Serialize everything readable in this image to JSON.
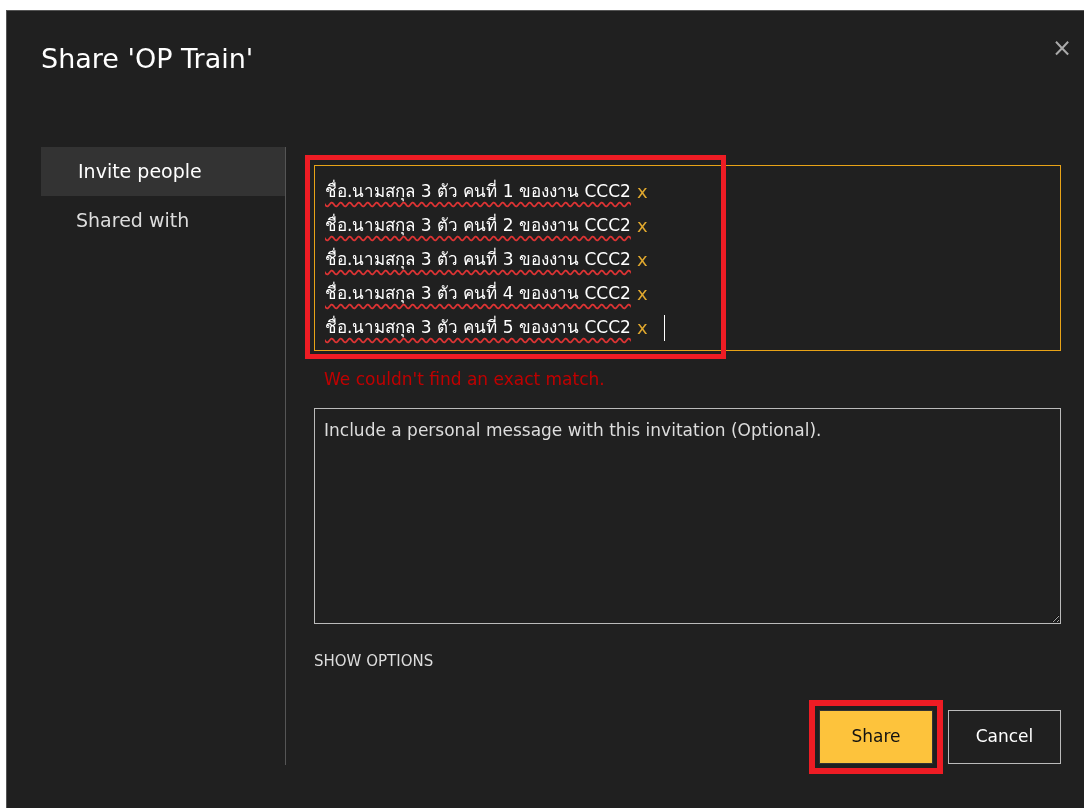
{
  "dialog": {
    "title": "Share 'OP Train'",
    "close": "×"
  },
  "sidebar": {
    "items": [
      {
        "label": "Invite people",
        "selected": true
      },
      {
        "label": "Shared with",
        "selected": false
      }
    ]
  },
  "recipients": {
    "highlighted": true,
    "items": [
      {
        "name": "ชื่อ.นามสกุล 3 ตัว คนที่ 1 ของงาน CCC2",
        "remove": "x"
      },
      {
        "name": "ชื่อ.นามสกุล 3 ตัว คนที่ 2 ของงาน CCC2",
        "remove": "x"
      },
      {
        "name": "ชื่อ.นามสกุล 3 ตัว คนที่ 3 ของงาน CCC2",
        "remove": "x"
      },
      {
        "name": "ชื่อ.นามสกุล 3 ตัว คนที่ 4 ของงาน CCC2",
        "remove": "x"
      },
      {
        "name": "ชื่อ.นามสกุล 3 ตัว คนที่ 5 ของงาน CCC2",
        "remove": "x"
      }
    ]
  },
  "error": "We couldn't find an exact match.",
  "message": {
    "placeholder": "Include a personal message with this invitation (Optional)."
  },
  "show_options": "SHOW OPTIONS",
  "buttons": [
    {
      "label": "Share",
      "kind": "primary",
      "highlighted": true
    },
    {
      "label": "Cancel",
      "kind": "secondary",
      "highlighted": false
    }
  ]
}
